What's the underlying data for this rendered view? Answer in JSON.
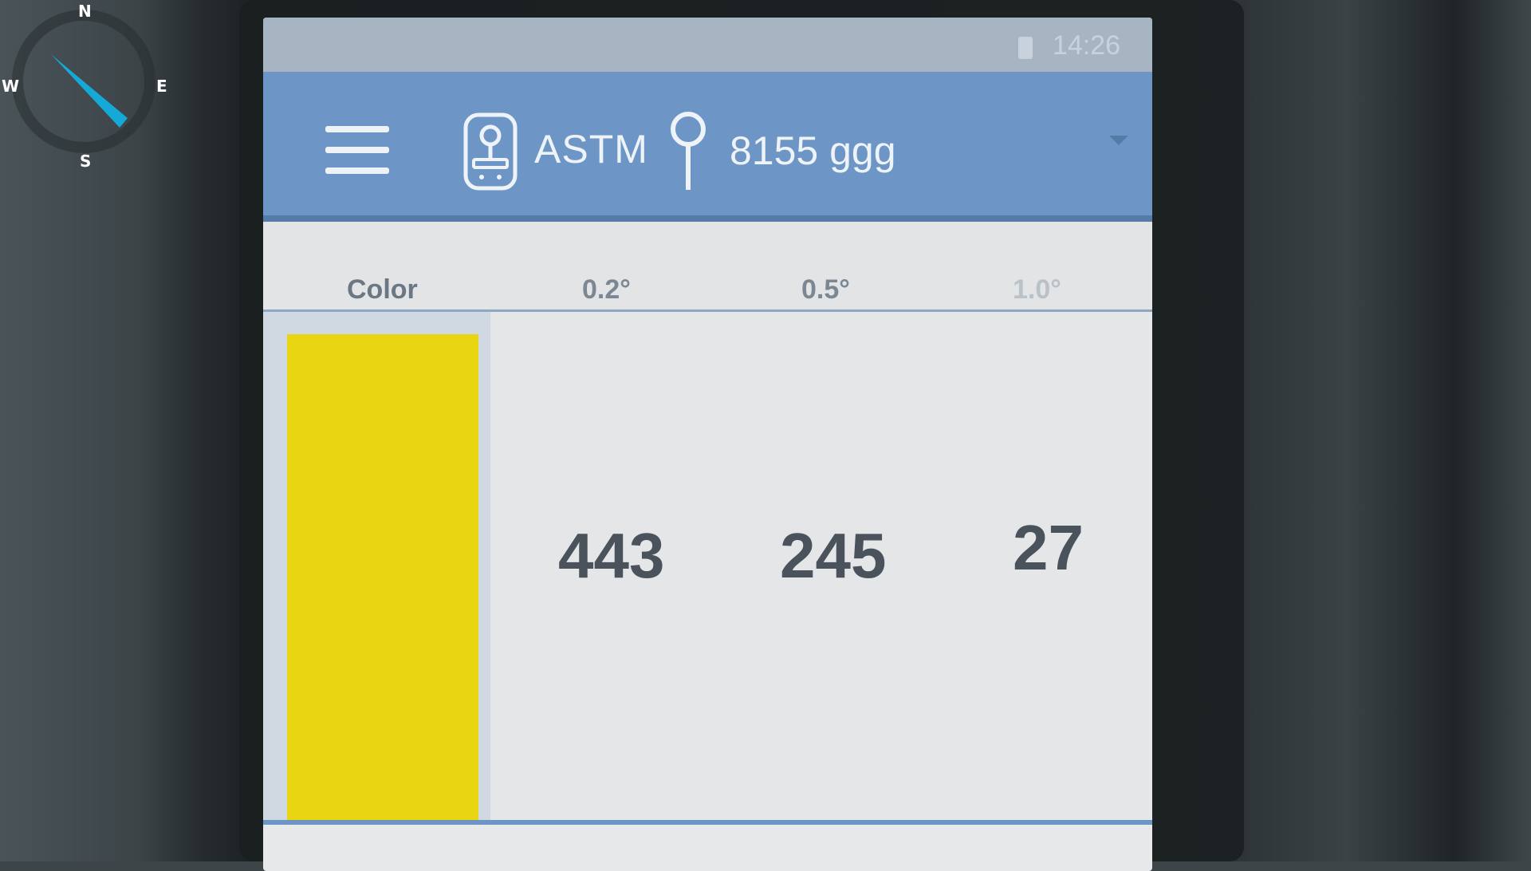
{
  "compass": {
    "north": "N",
    "south": "S",
    "west": "W",
    "east": "E",
    "needle_color": "#14a9d6"
  },
  "status_bar": {
    "time": "14:26"
  },
  "app_bar": {
    "menu_icon": "hamburger-menu-icon",
    "device_icon": "instrument-icon",
    "title": "ASTM",
    "location_icon": "pin-icon",
    "sample_name": "8155 ggg",
    "dropdown_icon": "dropdown-arrow-icon",
    "accent": "#6d95c6"
  },
  "table": {
    "headers": [
      "Color",
      "0.2°",
      "0.5°",
      "1.0°"
    ],
    "row": {
      "swatch_color": "#ead512",
      "values": [
        "443",
        "245",
        "27"
      ]
    }
  }
}
